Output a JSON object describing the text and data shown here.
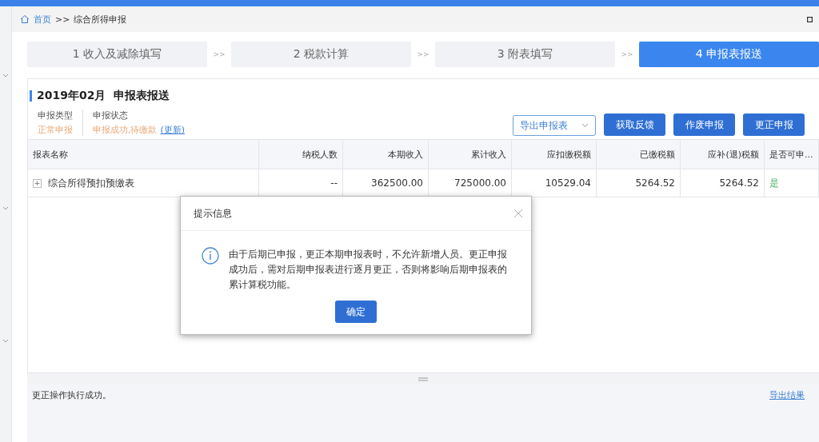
{
  "breadcrumb": {
    "home": "首页",
    "separator": ">>",
    "current": "综合所得申报"
  },
  "steps": [
    {
      "label": "1 收入及减除填写",
      "selected": false
    },
    {
      "label": "2 税款计算",
      "selected": false
    },
    {
      "label": "3 附表填写",
      "selected": false
    },
    {
      "label": "4 申报表报送",
      "selected": true
    }
  ],
  "step_separators": [
    ">>",
    ">>",
    ">>"
  ],
  "panel": {
    "title": "2019年02月  申报表报送",
    "info": [
      {
        "label": "申报类型",
        "value": "正常申报"
      },
      {
        "label": "申报状态",
        "value": "申报成功,待缴款",
        "link": "(更新)"
      }
    ],
    "export_dropdown": "导出申报表",
    "buttons": [
      "获取反馈",
      "作废申报",
      "更正申报"
    ]
  },
  "table": {
    "columns": [
      "报表名称",
      "纳税人数",
      "本期收入",
      "累计收入",
      "应扣缴税额",
      "已缴税额",
      "应补(退)税额",
      "是否可申..."
    ],
    "rows": [
      {
        "expanded": false,
        "expander": "+",
        "cells": [
          "综合所得预扣预缴表",
          "--",
          "362500.00",
          "725000.00",
          "10529.04",
          "5264.52",
          "5264.52",
          "是"
        ]
      }
    ]
  },
  "dialog": {
    "title": "提示信息",
    "message": "由于后期已申报，更正本期申报表时，不允许新增人员。更正申报成功后，需对后期申报表进行逐月更正，否则将影响后期申报表的累计算税功能。",
    "ok": "确定"
  },
  "log": {
    "message": "更正操作执行成功。",
    "link": "导出结果"
  }
}
